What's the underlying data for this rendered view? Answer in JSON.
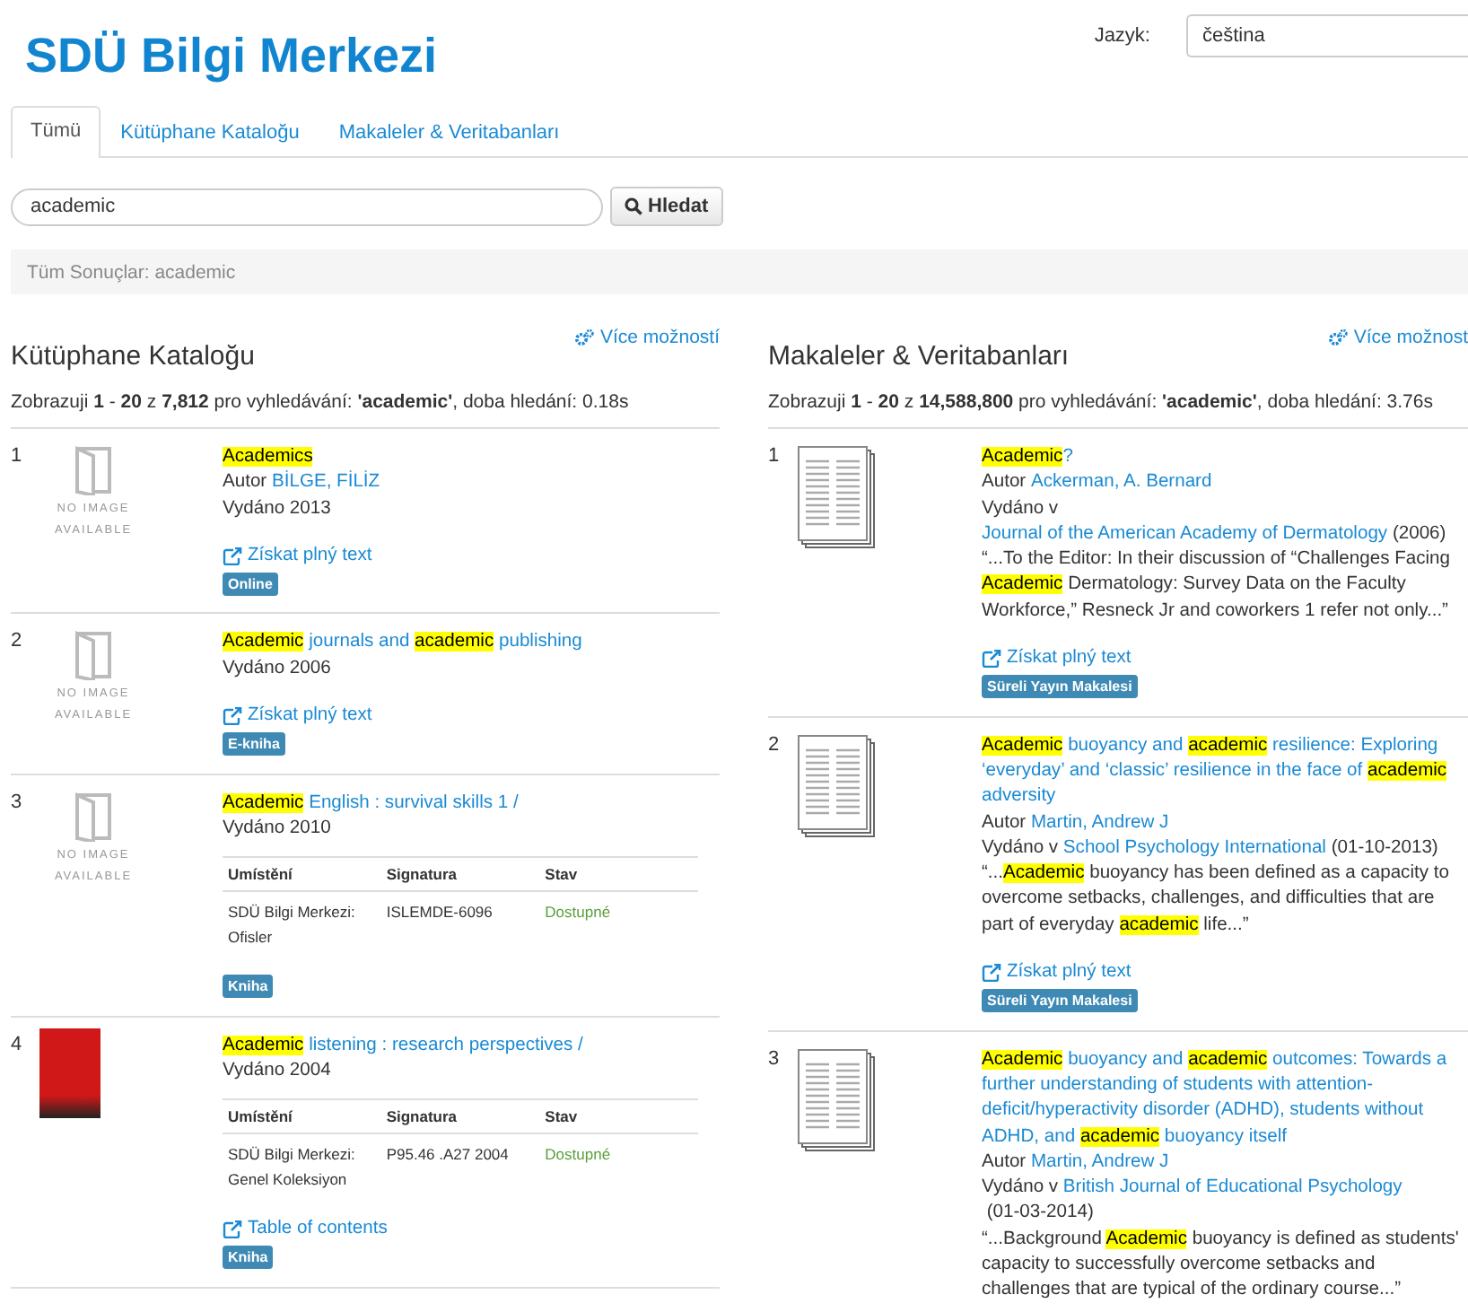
{
  "header": {
    "title": "SDÜ Bilgi Merkezi",
    "language_label": "Jazyk:",
    "language_value": "čeština"
  },
  "tabs": [
    {
      "label": "Tümü",
      "selected": true
    },
    {
      "label": "Kütüphane Kataloğu",
      "selected": false
    },
    {
      "label": "Makaleler & Veritabanları",
      "selected": false
    }
  ],
  "search": {
    "value": "academic",
    "button": "Hledat"
  },
  "breadcrumb": "Tüm Sonuçlar: academic",
  "panels": [
    {
      "title": "Kütüphane Kataloğu",
      "more": "Více možností",
      "summary": "Zobrazuji **1** - **20** z **7,812** pro vyhledávání: **'academic'**, doba hledání: 0.18s",
      "results": [
        {
          "number": "1",
          "kind": "no-image",
          "caption": "NO IMAGE AVAILABLE",
          "title": [
            {
              "text": "Academics",
              "kind": "highlight"
            }
          ],
          "lines": [
            [
              {
                "text": "Autor ",
                "kind": "text"
              },
              {
                "text": "BİLGE, FİLİZ",
                "kind": "link"
              }
            ],
            [
              {
                "text": "Vydáno 2013",
                "kind": "text"
              }
            ]
          ],
          "link": "Získat plný text",
          "format": "Online"
        },
        {
          "number": "2",
          "kind": "no-image",
          "caption": "NO IMAGE AVAILABLE",
          "title": [
            {
              "text": "Academic",
              "kind": "highlight"
            },
            {
              "text": " journals and ",
              "kind": "link"
            },
            {
              "text": "academic",
              "kind": "highlight"
            },
            {
              "text": " publishing",
              "kind": "link"
            }
          ],
          "lines": [
            [
              {
                "text": "Vydáno 2006",
                "kind": "text"
              }
            ]
          ],
          "link": "Získat plný text",
          "format": "E-kniha"
        },
        {
          "number": "3",
          "kind": "no-image",
          "caption": "NO IMAGE AVAILABLE",
          "title": [
            {
              "text": "Academic",
              "kind": "highlight"
            },
            {
              "text": " English : survival skills 1 /",
              "kind": "link"
            }
          ],
          "lines": [
            [
              {
                "text": "Vydáno 2010",
                "kind": "text"
              }
            ]
          ],
          "holdings": {
            "columns": [
              "Umístění",
              "Signatura",
              "Stav"
            ],
            "rows": [
              [
                "SDÜ Bilgi Merkezi: Ofisler",
                "ISLEMDE-6096",
                "Dostupné"
              ]
            ]
          },
          "format": "Kniha"
        },
        {
          "number": "4",
          "kind": "cover",
          "title": [
            {
              "text": "Academic",
              "kind": "highlight"
            },
            {
              "text": " listening : research perspectives /",
              "kind": "link"
            }
          ],
          "lines": [
            [
              {
                "text": "Vydáno 2004",
                "kind": "text"
              }
            ]
          ],
          "holdings": {
            "columns": [
              "Umístění",
              "Signatura",
              "Stav"
            ],
            "rows": [
              [
                "SDÜ Bilgi Merkezi: Genel Koleksiyon",
                "P95.46 .A27 2004",
                "Dostupné"
              ]
            ]
          },
          "link": "Table of contents",
          "format": "Kniha"
        }
      ]
    },
    {
      "title": "Makaleler & Veritabanları",
      "more": "Více možnost",
      "summary": "Zobrazuji **1** - **20** z **14,588,800** pro vyhledávání: **'academic'**, doba hledání: 3.76s",
      "results": [
        {
          "number": "1",
          "kind": "article",
          "title": [
            {
              "text": "Academic",
              "kind": "highlight"
            },
            {
              "text": "?",
              "kind": "link"
            }
          ],
          "lines": [
            [
              {
                "text": "Autor ",
                "kind": "text"
              },
              {
                "text": "Ackerman, A. Bernard",
                "kind": "link"
              }
            ],
            [
              {
                "text": "Vydáno v ",
                "kind": "text"
              },
              {
                "text": "Journal of the American Academy of Dermatology",
                "kind": "link"
              },
              {
                "text": " (2006)",
                "kind": "text"
              }
            ]
          ],
          "snippet": [
            {
              "text": "“...To the Editor: In their discussion of “Challenges Facing ",
              "kind": "text"
            },
            {
              "text": "Academic",
              "kind": "highlight"
            },
            {
              "text": " Dermatology: Survey Data on the Faculty Workforce,” Resneck Jr and coworkers 1 refer not only...”",
              "kind": "text"
            }
          ],
          "link": "Získat plný text",
          "format": "Süreli Yayın Makalesi"
        },
        {
          "number": "2",
          "kind": "article",
          "title": [
            {
              "text": "Academic",
              "kind": "highlight"
            },
            {
              "text": " buoyancy and ",
              "kind": "link"
            },
            {
              "text": "academic",
              "kind": "highlight"
            },
            {
              "text": " resilience: Exploring ‘everyday’ and ‘classic’ resilience in the face of ",
              "kind": "link"
            },
            {
              "text": "academic",
              "kind": "highlight"
            },
            {
              "text": " adversity",
              "kind": "link"
            }
          ],
          "lines": [
            [
              {
                "text": "Autor ",
                "kind": "text"
              },
              {
                "text": "Martin, Andrew J",
                "kind": "link"
              }
            ],
            [
              {
                "text": "Vydáno v ",
                "kind": "text"
              },
              {
                "text": "School Psychology International",
                "kind": "link"
              },
              {
                "text": " (01-10-2013)",
                "kind": "text"
              }
            ]
          ],
          "snippet": [
            {
              "text": "“...",
              "kind": "text"
            },
            {
              "text": "Academic",
              "kind": "highlight"
            },
            {
              "text": " buoyancy has been defined as a capacity to overcome setbacks, challenges, and difficulties that are part of everyday ",
              "kind": "text"
            },
            {
              "text": "academic",
              "kind": "highlight"
            },
            {
              "text": " life...”",
              "kind": "text"
            }
          ],
          "link": "Získat plný text",
          "format": "Süreli Yayın Makalesi"
        },
        {
          "number": "3",
          "kind": "article",
          "title": [
            {
              "text": "Academic",
              "kind": "highlight"
            },
            {
              "text": " buoyancy and ",
              "kind": "link"
            },
            {
              "text": "academic",
              "kind": "highlight"
            },
            {
              "text": " outcomes: Towards a further understanding of students with attention-deficit/hyperactivity disorder (ADHD), students without ADHD, and ",
              "kind": "link"
            },
            {
              "text": "academic",
              "kind": "highlight"
            },
            {
              "text": " buoyancy itself",
              "kind": "link"
            }
          ],
          "lines": [
            [
              {
                "text": "Autor ",
                "kind": "text"
              },
              {
                "text": "Martin, Andrew J",
                "kind": "link"
              }
            ],
            [
              {
                "text": "Vydáno v ",
                "kind": "text"
              },
              {
                "text": "British Journal of Educational Psychology",
                "kind": "link"
              },
              {
                "text": " (01-03-2014)",
                "kind": "text"
              }
            ]
          ],
          "snippet": [
            {
              "text": "“...Background ",
              "kind": "text"
            },
            {
              "text": "Academic",
              "kind": "highlight"
            },
            {
              "text": " buoyancy is defined as students' capacity to successfully overcome setbacks and challenges that are typical of the ordinary course...”",
              "kind": "text"
            }
          ]
        }
      ]
    }
  ]
}
